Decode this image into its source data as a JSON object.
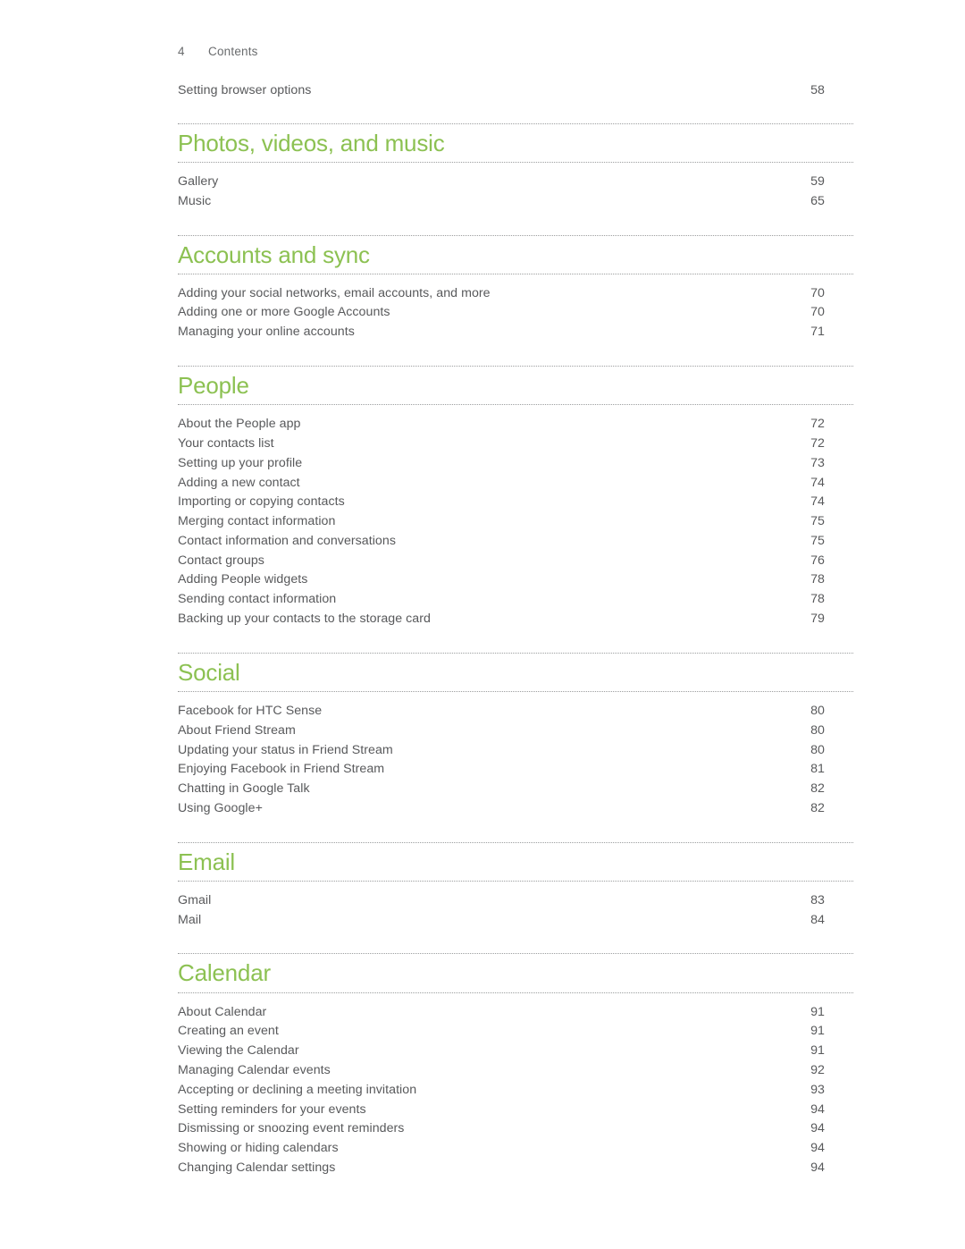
{
  "header": {
    "folio": "4",
    "title": "Contents"
  },
  "colors": {
    "heading_green": "#8cc152",
    "body_text": "#58595b",
    "rule": "#9c9e9f"
  },
  "pre_entries": [
    {
      "label": "Setting browser options",
      "page": "58"
    }
  ],
  "sections": [
    {
      "title": "Photos, videos, and music",
      "entries": [
        {
          "label": "Gallery",
          "page": "59"
        },
        {
          "label": "Music",
          "page": "65"
        }
      ]
    },
    {
      "title": "Accounts and sync",
      "entries": [
        {
          "label": "Adding your social networks, email accounts, and more",
          "page": "70"
        },
        {
          "label": "Adding one or more Google Accounts",
          "page": "70"
        },
        {
          "label": "Managing your online accounts",
          "page": "71"
        }
      ]
    },
    {
      "title": "People",
      "entries": [
        {
          "label": "About the People app",
          "page": "72"
        },
        {
          "label": "Your contacts list",
          "page": "72"
        },
        {
          "label": "Setting up your profile",
          "page": "73"
        },
        {
          "label": "Adding a new contact",
          "page": "74"
        },
        {
          "label": "Importing or copying contacts",
          "page": "74"
        },
        {
          "label": "Merging contact information",
          "page": "75"
        },
        {
          "label": "Contact information and conversations",
          "page": "75"
        },
        {
          "label": "Contact groups",
          "page": "76"
        },
        {
          "label": "Adding People widgets",
          "page": "78"
        },
        {
          "label": "Sending contact information",
          "page": "78"
        },
        {
          "label": "Backing up your contacts to the storage card",
          "page": "79"
        }
      ]
    },
    {
      "title": "Social",
      "entries": [
        {
          "label": "Facebook for HTC Sense",
          "page": "80"
        },
        {
          "label": "About Friend Stream",
          "page": "80"
        },
        {
          "label": "Updating your status in Friend Stream",
          "page": "80"
        },
        {
          "label": "Enjoying Facebook in Friend Stream",
          "page": "81"
        },
        {
          "label": "Chatting in Google Talk",
          "page": "82"
        },
        {
          "label": "Using Google+",
          "page": "82"
        }
      ]
    },
    {
      "title": "Email",
      "entries": [
        {
          "label": "Gmail",
          "page": "83"
        },
        {
          "label": "Mail",
          "page": "84"
        }
      ]
    },
    {
      "title": "Calendar",
      "entries": [
        {
          "label": "About Calendar",
          "page": "91"
        },
        {
          "label": "Creating an event",
          "page": "91"
        },
        {
          "label": "Viewing the Calendar",
          "page": "91"
        },
        {
          "label": "Managing Calendar events",
          "page": "92"
        },
        {
          "label": "Accepting or declining a meeting invitation",
          "page": "93"
        },
        {
          "label": "Setting reminders for your events",
          "page": "94"
        },
        {
          "label": "Dismissing or snoozing event reminders",
          "page": "94"
        },
        {
          "label": "Showing or hiding calendars",
          "page": "94"
        },
        {
          "label": "Changing Calendar settings",
          "page": "94"
        }
      ]
    }
  ]
}
